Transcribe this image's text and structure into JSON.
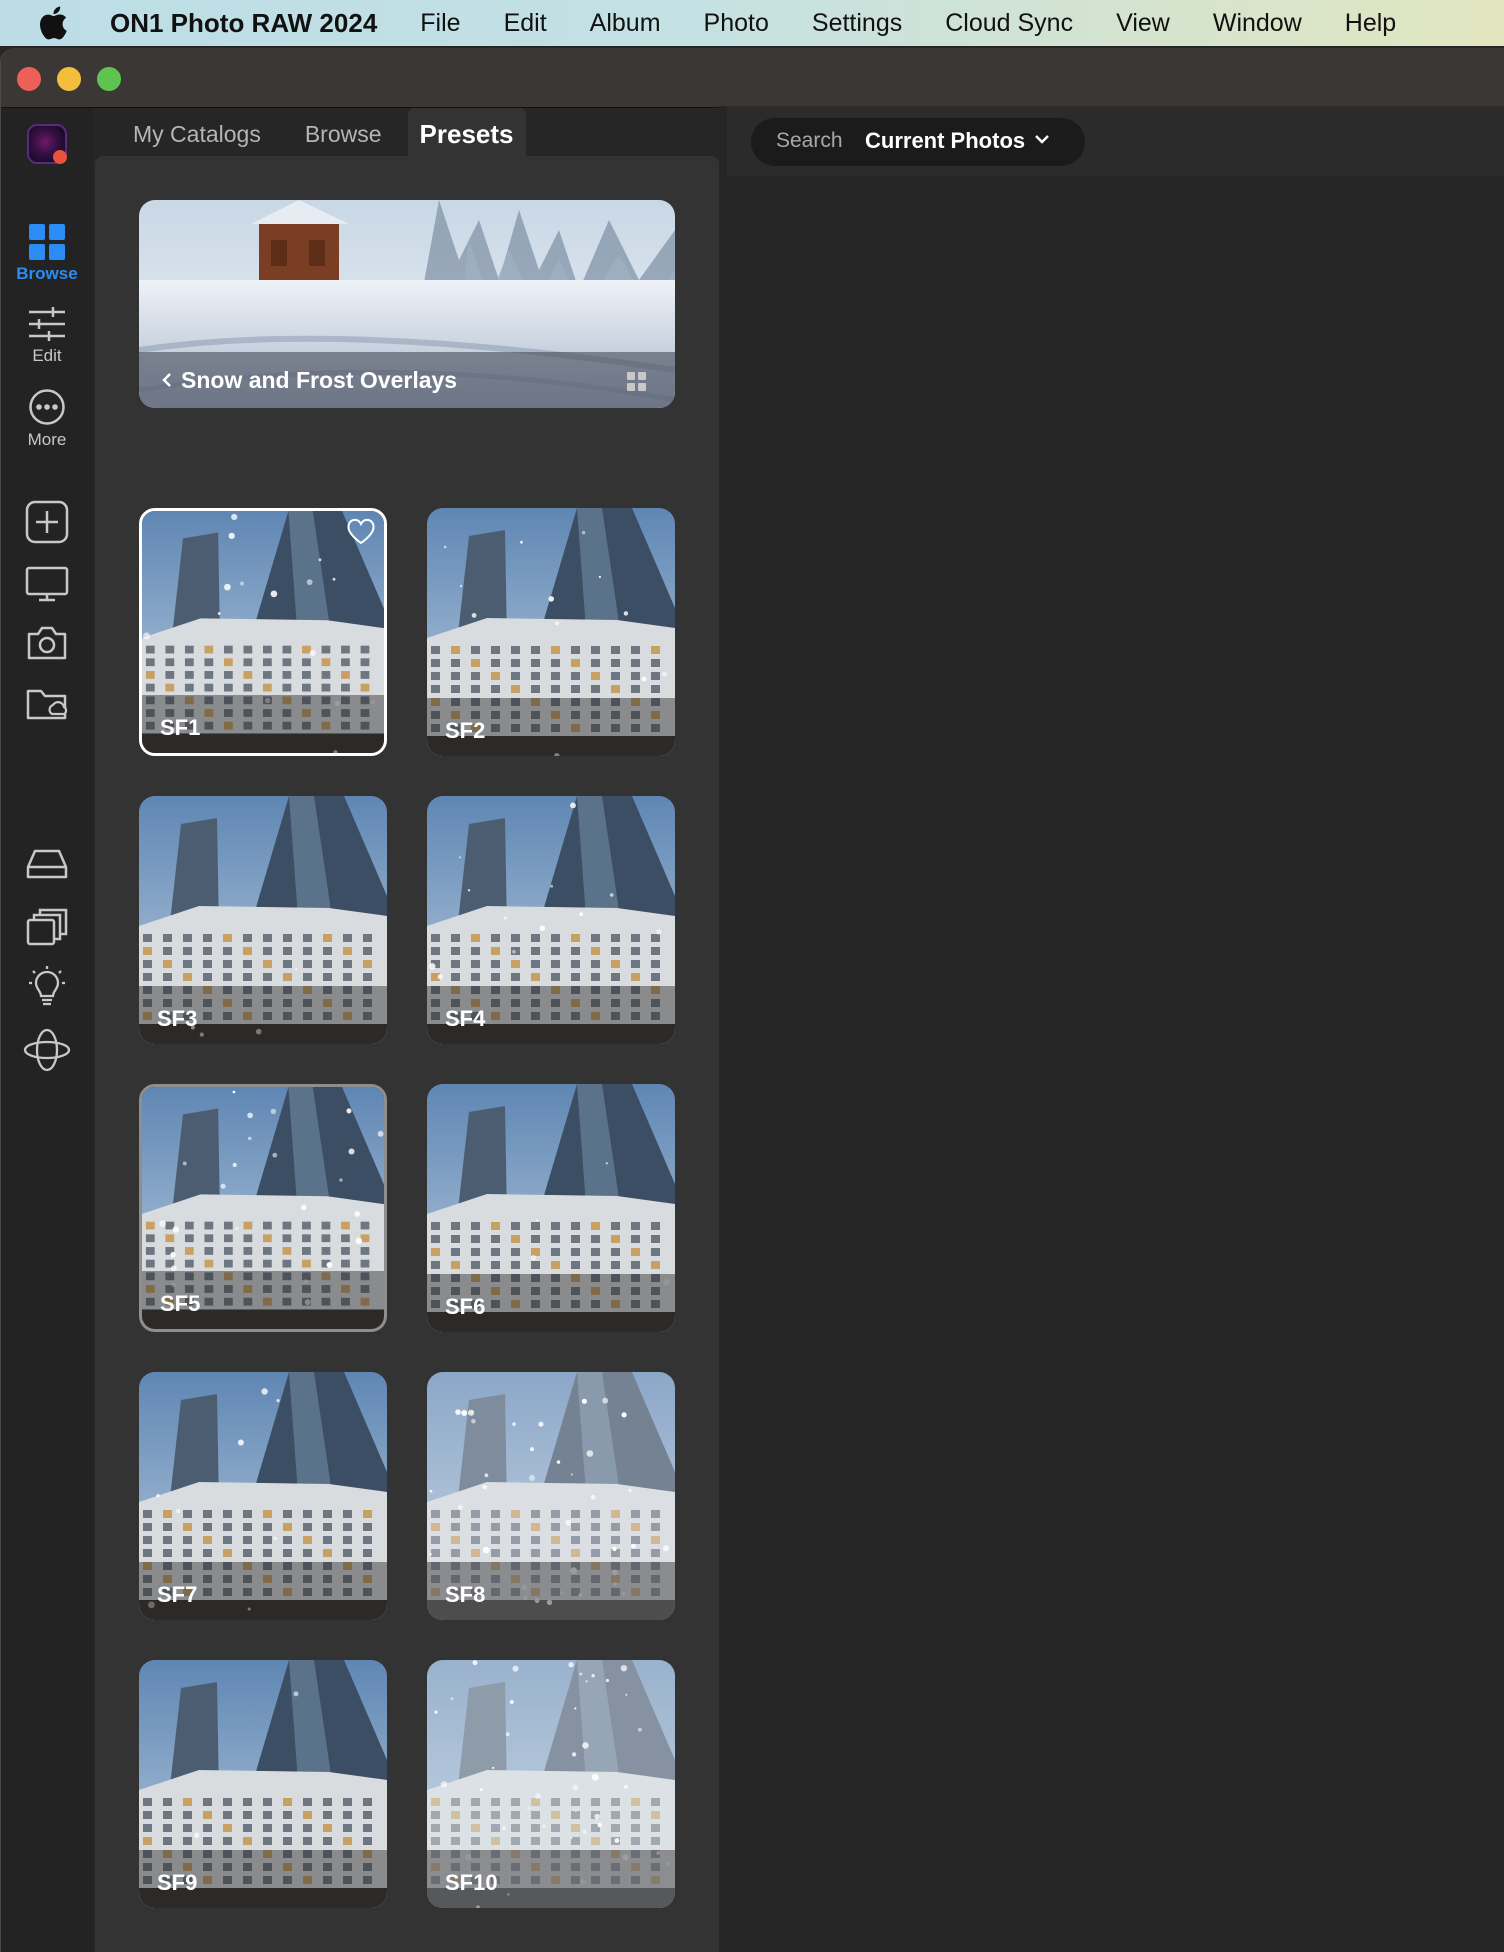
{
  "menubar": {
    "app_name": "ON1 Photo RAW 2024",
    "items": [
      "File",
      "Edit",
      "Album",
      "Photo",
      "Settings",
      "Cloud Sync",
      "View",
      "Window",
      "Help"
    ]
  },
  "rail": {
    "browse_label": "Browse",
    "edit_label": "Edit",
    "more_label": "More",
    "icons": [
      "add-icon",
      "display-icon",
      "camera-icon",
      "cloud-folder-icon",
      "drive-icon",
      "albums-icon",
      "lightbulb-icon",
      "globe-icon"
    ]
  },
  "tabs": [
    "My Catalogs",
    "Browse",
    "Presets"
  ],
  "active_tab": "Presets",
  "preset_category": {
    "title": "Snow and Frost Overlays"
  },
  "presets": [
    {
      "label": "SF1",
      "state": "selected",
      "snow": 0.4
    },
    {
      "label": "SF2",
      "state": "normal",
      "snow": 0.3
    },
    {
      "label": "SF3",
      "state": "normal",
      "snow": 0.1
    },
    {
      "label": "SF4",
      "state": "normal",
      "snow": 0.3
    },
    {
      "label": "SF5",
      "state": "hovered",
      "snow": 0.6
    },
    {
      "label": "SF6",
      "state": "normal",
      "snow": 0.1
    },
    {
      "label": "SF7",
      "state": "normal",
      "snow": 0.2
    },
    {
      "label": "SF8",
      "state": "normal",
      "snow": 0.9
    },
    {
      "label": "SF9",
      "state": "normal",
      "snow": 0.05
    },
    {
      "label": "SF10",
      "state": "normal",
      "snow": 1.0
    }
  ],
  "search": {
    "label": "Search",
    "scope": "Current Photos"
  },
  "colors": {
    "accent": "#2a8cf4",
    "panel": "#333333",
    "background": "#262626"
  }
}
